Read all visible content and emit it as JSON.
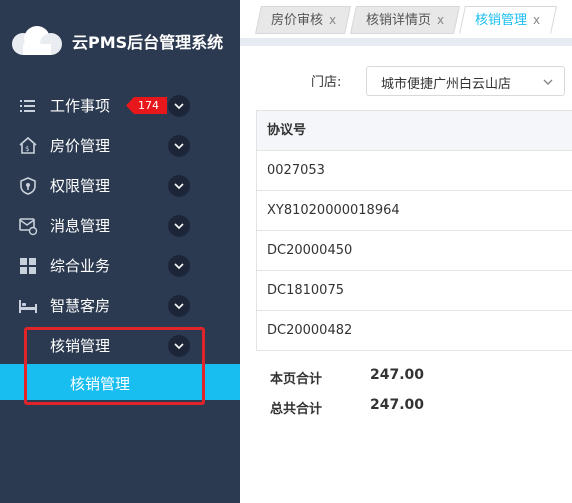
{
  "app": {
    "title": "云PMS后台管理系统"
  },
  "sidebar": {
    "items": [
      {
        "label": "工作事项",
        "icon": "list-icon",
        "badge": "174"
      },
      {
        "label": "房价管理",
        "icon": "house-price-icon"
      },
      {
        "label": "权限管理",
        "icon": "shield-icon"
      },
      {
        "label": "消息管理",
        "icon": "message-settings-icon"
      },
      {
        "label": "综合业务",
        "icon": "grid-icon"
      },
      {
        "label": "智慧客房",
        "icon": "bed-icon"
      },
      {
        "label": "核销管理",
        "icon": "",
        "expanded": true
      }
    ],
    "sub_items": [
      {
        "label": "核销管理",
        "active": true
      }
    ],
    "active_color": "#19bef1",
    "bg_color": "#2b3a50"
  },
  "tabs": [
    {
      "label": "房价审核",
      "close": "x",
      "active": false
    },
    {
      "label": "核销详情页",
      "close": "x",
      "active": false
    },
    {
      "label": "核销管理",
      "close": "x",
      "active": true
    }
  ],
  "filter": {
    "store_label": "门店:",
    "store_value": "城市便捷广州白云山店"
  },
  "table": {
    "header": "协议号",
    "rows": [
      "0027053",
      "XY81020000018964",
      "DC20000450",
      "DC1810075",
      "DC20000482"
    ]
  },
  "summary": {
    "page_total_label": "本页合计",
    "page_total_value": "247.00",
    "grand_total_label": "总共合计",
    "grand_total_value": "247.00"
  }
}
